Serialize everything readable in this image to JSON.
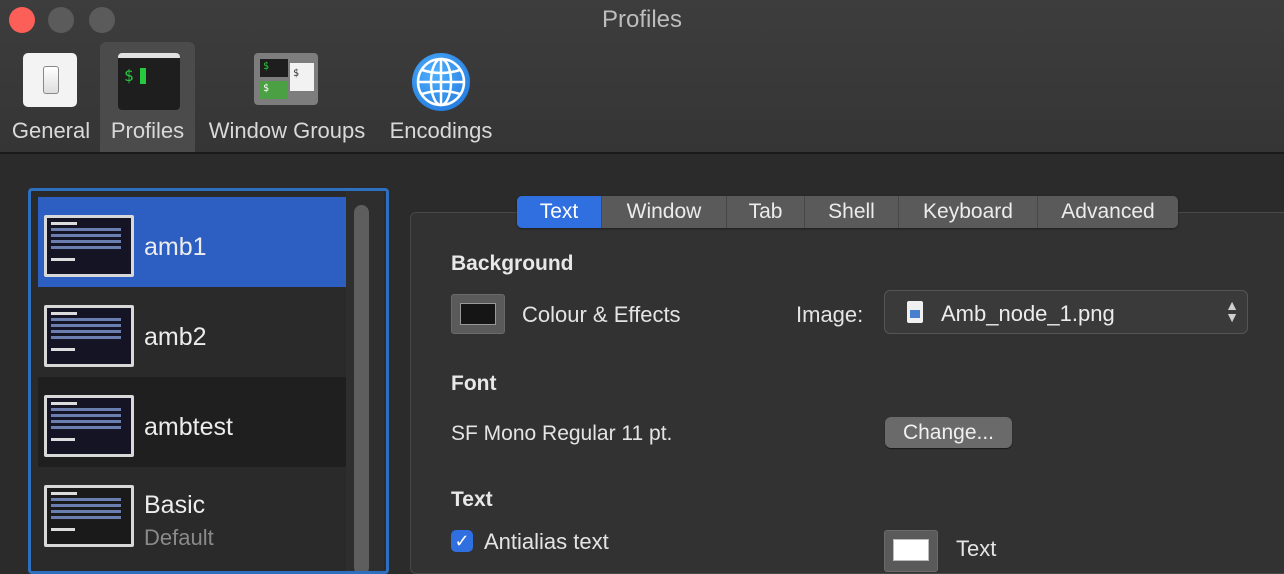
{
  "window": {
    "title": "Profiles"
  },
  "toolbar": {
    "items": [
      {
        "label": "General",
        "icon": "general-icon"
      },
      {
        "label": "Profiles",
        "icon": "terminal-icon",
        "selected": true
      },
      {
        "label": "Window Groups",
        "icon": "window-groups-icon"
      },
      {
        "label": "Encodings",
        "icon": "globe-icon"
      }
    ]
  },
  "terminal_icon": {
    "prompt": "$"
  },
  "window_groups_icon": {
    "prompt_a": "$",
    "prompt_b": "$",
    "prompt_c": "$"
  },
  "profiles": [
    {
      "name": "amb1",
      "selected": true
    },
    {
      "name": "amb2"
    },
    {
      "name": "ambtest"
    },
    {
      "name": "Basic",
      "subtitle": "Default"
    }
  ],
  "tabs": [
    "Text",
    "Window",
    "Tab",
    "Shell",
    "Keyboard",
    "Advanced"
  ],
  "active_tab": "Text",
  "text_tab": {
    "background_heading": "Background",
    "colour_effects_label": "Colour & Effects",
    "image_label": "Image:",
    "image_value": "Amb_node_1.png",
    "font_heading": "Font",
    "font_value": "SF Mono Regular 11 pt.",
    "change_button": "Change...",
    "text_heading": "Text",
    "antialias_label": "Antialias text",
    "antialias_checked": true,
    "text_colour_label": "Text"
  },
  "colors": {
    "accent": "#2f6fe0",
    "close": "#fc5f57",
    "selection": "#2d5fc3"
  }
}
